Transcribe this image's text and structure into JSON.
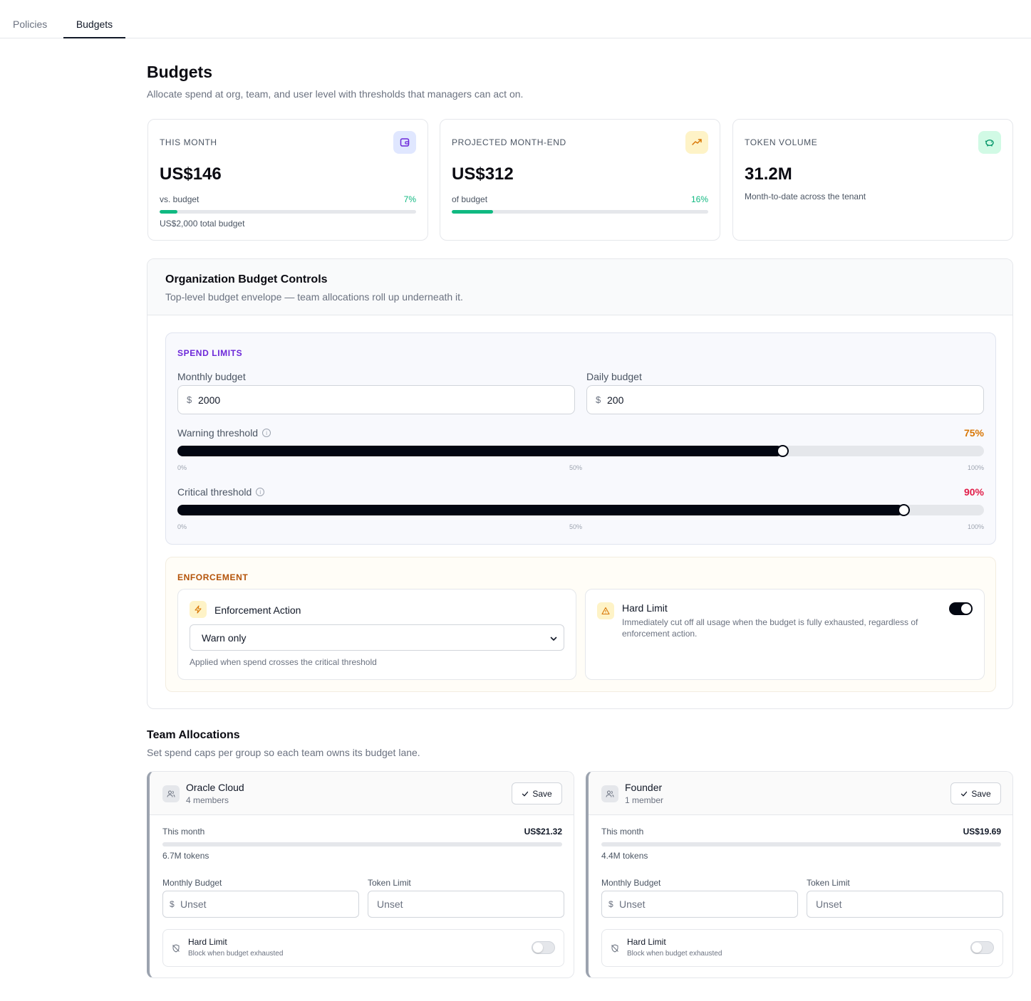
{
  "tabs": [
    {
      "label": "Policies",
      "active": false
    },
    {
      "label": "Budgets",
      "active": true
    }
  ],
  "page": {
    "title": "Budgets",
    "subtitle": "Allocate spend at org, team, and user level with thresholds that managers can act on."
  },
  "stats": {
    "this_month": {
      "label": "THIS MONTH",
      "icon": "wallet-icon",
      "value": "US$146",
      "row_label": "vs. budget",
      "pct": "7%",
      "progress": 0.07,
      "footer": "US$2,000 total budget"
    },
    "projected": {
      "label": "PROJECTED MONTH-END",
      "icon": "trending-up-icon",
      "value": "US$312",
      "row_label": "of budget",
      "pct": "16%",
      "progress": 0.16
    },
    "tokens": {
      "label": "TOKEN VOLUME",
      "icon": "piggy-bank-icon",
      "value": "31.2M",
      "description": "Month-to-date across the tenant"
    }
  },
  "org": {
    "title": "Organization Budget Controls",
    "subtitle": "Top-level budget envelope — team allocations roll up underneath it.",
    "spend_limits": {
      "section_label": "SPEND LIMITS",
      "monthly_label": "Monthly budget",
      "monthly_value": "2000",
      "daily_label": "Daily budget",
      "daily_value": "200",
      "currency": "$",
      "warning_label": "Warning threshold",
      "warning_pct": "75%",
      "warning_value": 0.75,
      "critical_label": "Critical threshold",
      "critical_pct": "90%",
      "critical_value": 0.9,
      "ticks": [
        "0%",
        "50%",
        "100%"
      ]
    },
    "enforcement": {
      "section_label": "ENFORCEMENT",
      "action_title": "Enforcement Action",
      "action_value": "Warn only",
      "action_help": "Applied when spend crosses the critical threshold",
      "hard_limit_title": "Hard Limit",
      "hard_limit_desc": "Immediately cut off all usage when the budget is fully exhausted, regardless of enforcement action.",
      "hard_limit_on": true
    }
  },
  "teams": {
    "title": "Team Allocations",
    "subtitle": "Set spend caps per group so each team owns its budget lane.",
    "save_label": "Save",
    "this_month_label": "This month",
    "monthly_budget_label": "Monthly Budget",
    "token_limit_label": "Token Limit",
    "currency": "$",
    "placeholder": "Unset",
    "hard_limit_title": "Hard Limit",
    "hard_limit_sub": "Block when budget exhausted",
    "items": [
      {
        "name": "Oracle Cloud",
        "members": "4 members",
        "spend": "US$21.32",
        "tokens": "6.7M tokens",
        "hard_limit_on": false
      },
      {
        "name": "Founder",
        "members": "1 member",
        "spend": "US$19.69",
        "tokens": "4.4M tokens",
        "hard_limit_on": false
      }
    ]
  },
  "colors": {
    "accent_purple": "#6d28d9",
    "accent_green": "#10b981",
    "warning_orange": "#d97706",
    "critical_red": "#e11d48",
    "enforcement_brown": "#b45309"
  }
}
